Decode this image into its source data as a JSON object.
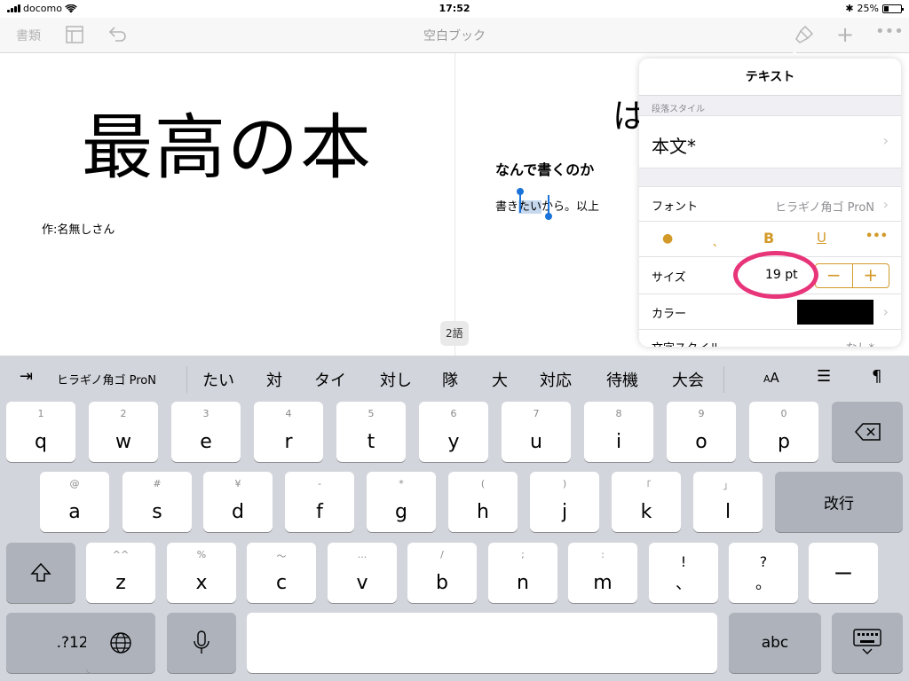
{
  "status": {
    "carrier": "docomo",
    "time": "17:52",
    "battery": "25%"
  },
  "toolbar": {
    "documents": "書類",
    "title": "空白ブック"
  },
  "document": {
    "title": "最高の本",
    "author": "作:名無しさん",
    "right_partial": "は",
    "heading": "なんで書くのか",
    "body_before": "書き",
    "body_selected": "たい",
    "body_after": "から。以上",
    "word_count": "2語"
  },
  "popover": {
    "title": "テキスト",
    "section_label": "段落スタイル",
    "paragraph_style": "本文*",
    "font_label": "フォント",
    "font_value": "ヒラギノ角ゴ ProN",
    "size_label": "サイズ",
    "size_value": "19 pt",
    "stepper_minus": "−",
    "stepper_plus": "+",
    "color_label": "カラー",
    "color_value": "#000000",
    "char_style_label": "文字スタイル",
    "char_style_value": "なし*",
    "accent_color": "#d39a2a",
    "highlight_color": "#e8357a"
  },
  "keyboard": {
    "font_name": "ヒラギノ角ゴ ProN",
    "suggestions": [
      "たい",
      "対",
      "タイ",
      "対し",
      "隊",
      "大",
      "対応",
      "待機",
      "大会"
    ],
    "row1": [
      {
        "sub": "1",
        "main": "q"
      },
      {
        "sub": "2",
        "main": "w"
      },
      {
        "sub": "3",
        "main": "e"
      },
      {
        "sub": "4",
        "main": "r"
      },
      {
        "sub": "5",
        "main": "t"
      },
      {
        "sub": "6",
        "main": "y"
      },
      {
        "sub": "7",
        "main": "u"
      },
      {
        "sub": "8",
        "main": "i"
      },
      {
        "sub": "9",
        "main": "o"
      },
      {
        "sub": "0",
        "main": "p"
      }
    ],
    "row2": [
      {
        "sub": "@",
        "main": "a"
      },
      {
        "sub": "#",
        "main": "s"
      },
      {
        "sub": "¥",
        "main": "d"
      },
      {
        "sub": "-",
        "main": "f"
      },
      {
        "sub": "*",
        "main": "g"
      },
      {
        "sub": "(",
        "main": "h"
      },
      {
        "sub": ")",
        "main": "j"
      },
      {
        "sub": "「",
        "main": "k"
      },
      {
        "sub": "」",
        "main": "l"
      }
    ],
    "row3": [
      {
        "sub": "^^",
        "main": "z"
      },
      {
        "sub": "%",
        "main": "x"
      },
      {
        "sub": "〜",
        "main": "c"
      },
      {
        "sub": "...",
        "main": "v"
      },
      {
        "sub": "/",
        "main": "b"
      },
      {
        "sub": ";",
        "main": "n"
      },
      {
        "sub": ":",
        "main": "m"
      },
      {
        "sub": "!",
        "main": "、"
      },
      {
        "sub": "?",
        "main": "。"
      }
    ],
    "return_label": "改行",
    "dash_label": "ー",
    "numbers_label": ".?123",
    "abc_label": "abc"
  }
}
